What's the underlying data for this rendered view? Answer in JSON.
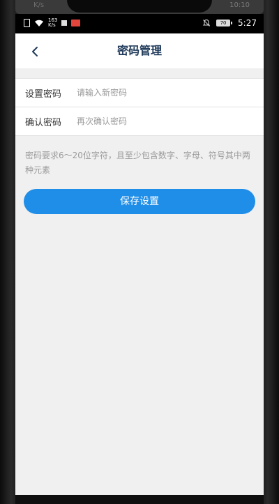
{
  "bezel": {
    "ghost_left": "K/s",
    "ghost_right": "10:10"
  },
  "status_bar": {
    "net_speed_value": "163",
    "net_speed_unit": "K/s",
    "battery_level": "70",
    "time": "5:27"
  },
  "nav": {
    "title": "密码管理"
  },
  "form": {
    "password": {
      "label": "设置密码",
      "placeholder": "请输入新密码",
      "value": ""
    },
    "confirm": {
      "label": "确认密码",
      "placeholder": "再次确认密码",
      "value": ""
    }
  },
  "hint": "密码要求6～20位字符，且至少包含数字、字母、符号其中两种元素",
  "save_button": {
    "label": "保存设置"
  },
  "colors": {
    "accent": "#1f8ee8",
    "title": "#1f3a5a",
    "background": "#f0f0f0",
    "status_bar": "#000000"
  }
}
